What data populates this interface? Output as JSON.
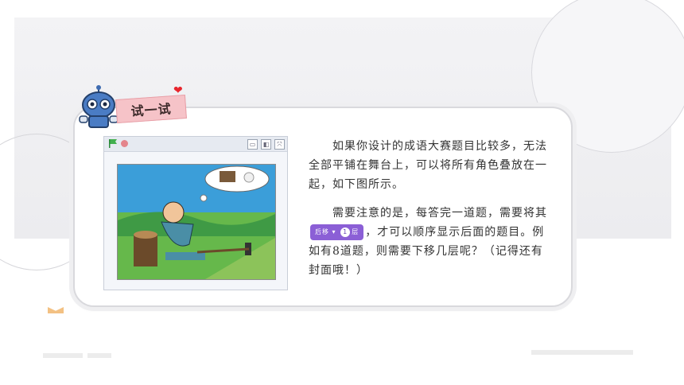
{
  "section_label": "试一试",
  "stage": {
    "buttons": [
      "▭",
      "◧",
      "⤧"
    ]
  },
  "text": {
    "paragraph1": "如果你设计的成语大赛题目比较多，无法全部平铺在舞台上，可以将所有角色叠放在一起，如下图所示。",
    "paragraph2_before": "需要注意的是，每答完一道题，需要将其",
    "block_label": "后移",
    "block_arrow": "▾",
    "block_value": "1",
    "block_suffix": "层",
    "paragraph2_after": "，才可以顺序显示后面的题目。例如有8道题，则需要下移几层呢？（记得还有封面哦！）"
  },
  "colors": {
    "label_bg": "#f6c3c8",
    "heart": "#e8262d",
    "block": "#8b5fd6"
  }
}
